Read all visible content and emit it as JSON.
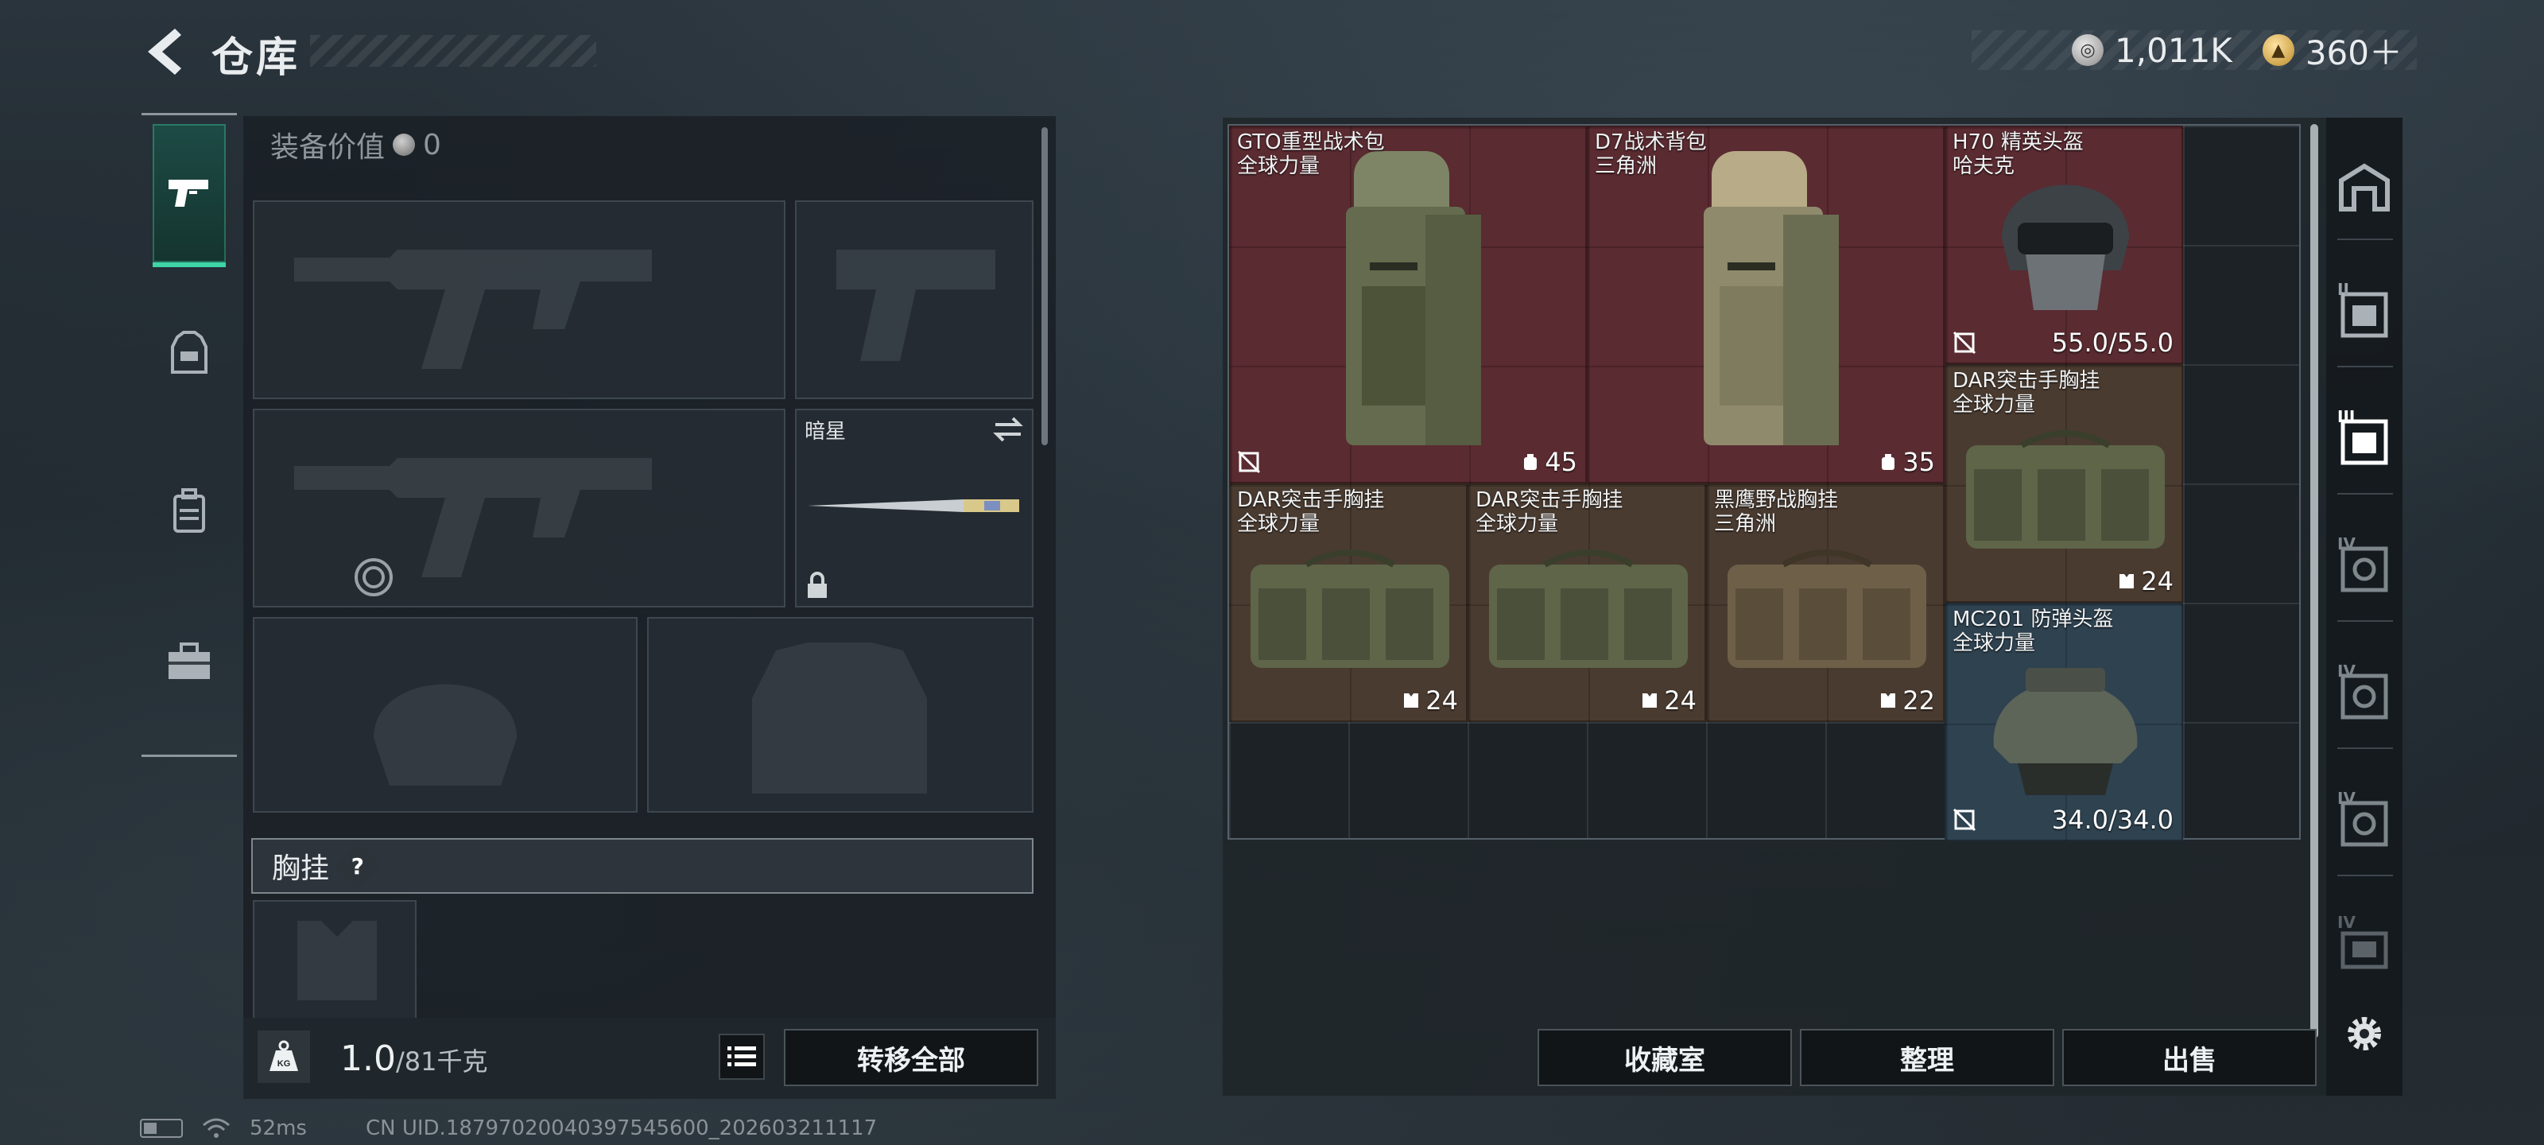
{
  "header": {
    "title": "仓库",
    "currencies": [
      {
        "icon": "silver-coin-icon",
        "value": "1,011K"
      },
      {
        "icon": "gold-coin-icon",
        "value": "360＋"
      }
    ]
  },
  "category_tabs": [
    {
      "name": "weapons",
      "icon": "pistol-icon",
      "active": true
    },
    {
      "name": "armor",
      "icon": "armor-icon",
      "active": false
    },
    {
      "name": "backpack",
      "icon": "backpack-icon",
      "active": false
    },
    {
      "name": "supplies",
      "icon": "toolbox-icon",
      "active": false
    }
  ],
  "loadout": {
    "equip_value_label": "装备价值",
    "equip_value": "0",
    "melee_name": "暗星",
    "chest_rig_label": "胸挂",
    "chest_rig_help": "?",
    "weight_current": "1.0",
    "weight_max": "/81千克",
    "weight_icon_text": "KG",
    "transfer_all_label": "转移全部"
  },
  "warehouse_items": [
    {
      "name": "GTO重型战术包",
      "origin": "全球力量",
      "stat": "45",
      "stat_icon": "capacity-icon",
      "color": "red"
    },
    {
      "name": "D7战术背包",
      "origin": "三角洲",
      "stat": "35",
      "stat_icon": "capacity-icon",
      "color": "red"
    },
    {
      "name": "H70 精英头盔",
      "origin": "哈夫克",
      "stat": "55.0/55.0",
      "stat_icon": "durability",
      "color": "red"
    },
    {
      "name": "DAR突击手胸挂",
      "origin": "全球力量",
      "stat": "24",
      "stat_icon": "vest-capacity-icon",
      "color": "brown"
    },
    {
      "name": "DAR突击手胸挂",
      "origin": "全球力量",
      "stat": "24",
      "stat_icon": "vest-capacity-icon",
      "color": "brown"
    },
    {
      "name": "DAR突击手胸挂",
      "origin": "全球力量",
      "stat": "24",
      "stat_icon": "vest-capacity-icon",
      "color": "brown"
    },
    {
      "name": "黑鹰野战胸挂",
      "origin": "三角洲",
      "stat": "22",
      "stat_icon": "vest-capacity-icon",
      "color": "brown"
    },
    {
      "name": "MC201 防弹头盔",
      "origin": "全球力量",
      "stat": "34.0/34.0",
      "stat_icon": "durability",
      "color": "blue"
    }
  ],
  "right_rail": {
    "level_labels": [
      "II",
      "III",
      "IV",
      "IV",
      "IV",
      "IV"
    ]
  },
  "actions": {
    "collection_room": "收藏室",
    "organize": "整理",
    "sell": "出售"
  },
  "status": {
    "ping": "52ms",
    "uid": "CN UID.18797020040397545600_202603211117"
  },
  "colors": {
    "accent": "#3ed4a6",
    "item_red": "#5a2b31",
    "item_brown": "#4a3b30",
    "item_blue": "#2e4250"
  }
}
